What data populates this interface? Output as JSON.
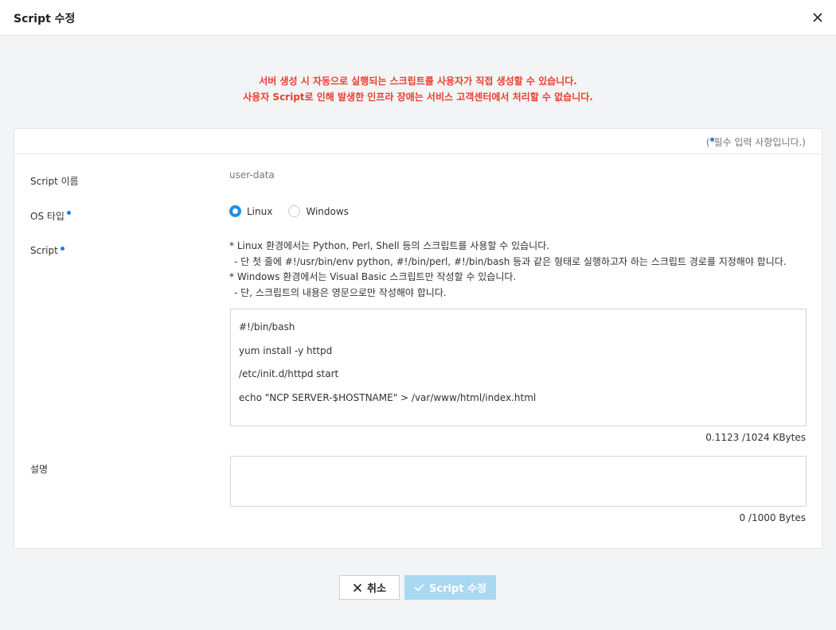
{
  "header": {
    "title": "Script 수정",
    "close_icon": "close-icon"
  },
  "notice": {
    "line1": "서버 생성 시 자동으로 실행되는 스크립트를 사용자가 직접 생성할 수 있습니다.",
    "line2": "사용자 Script로 인해 발생한 인프라 장애는 서비스 고객센터에서 처리할 수 없습니다.",
    "color": "#e8402f"
  },
  "required_note": {
    "open": "(",
    "text": "필수 입력 사항입니다.)"
  },
  "form": {
    "name_label": "Script 이름",
    "name_value": "user-data",
    "os_label": "OS 타입",
    "os_options": [
      "Linux",
      "Windows"
    ],
    "os_selected": "Linux",
    "script_label": "Script",
    "help_lines": [
      "* Linux 환경에서는 Python, Perl, Shell 등의 스크립트를 사용할 수 있습니다.",
      "  - 단 첫 줄에 #!/usr/bin/env python, #!/bin/perl, #!/bin/bash 등과 같은 형태로 실행하고자 하는 스크립트 경로를 지정해야 합니다.",
      "* Windows 환경에서는 Visual Basic 스크립트만 작성할 수 있습니다.",
      "  - 단, 스크립트의 내용은 영문으로만 작성해야 합니다."
    ],
    "script_lines": [
      "#!/bin/bash",
      "yum install -y httpd",
      "/etc/init.d/httpd start",
      "echo \"NCP SERVER-$HOSTNAME\" > /var/www/html/index.html"
    ],
    "script_counter": "0.1123 /1024 KBytes",
    "desc_label": "설명",
    "desc_value": "",
    "desc_counter": "0 /1000 Bytes"
  },
  "buttons": {
    "cancel_label": "취소",
    "submit_label": "Script 수정"
  },
  "colors": {
    "accent": "#1f8fe6",
    "required_dot": "#1f7be6",
    "submit_disabled": "#a9d9f2"
  }
}
